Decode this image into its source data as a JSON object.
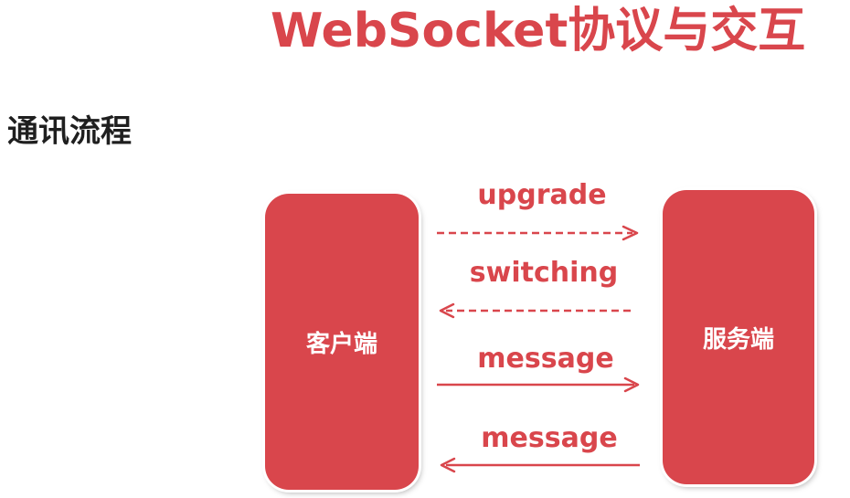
{
  "slide": {
    "title": "WebSocket协议与交互",
    "subtitle": "通讯流程"
  },
  "nodes": {
    "client": "客户端",
    "server": "服务端"
  },
  "messages": [
    {
      "label": "upgrade",
      "direction": "client-to-server",
      "line": "dashed"
    },
    {
      "label": "switching",
      "direction": "server-to-client",
      "line": "dashed"
    },
    {
      "label": "message",
      "direction": "client-to-server",
      "line": "solid"
    },
    {
      "label": "message",
      "direction": "server-to-client",
      "line": "solid"
    }
  ],
  "colors": {
    "accent": "#d9464c",
    "text": "#1f1f1f",
    "node_text": "#ffffff",
    "background": "#ffffff"
  }
}
